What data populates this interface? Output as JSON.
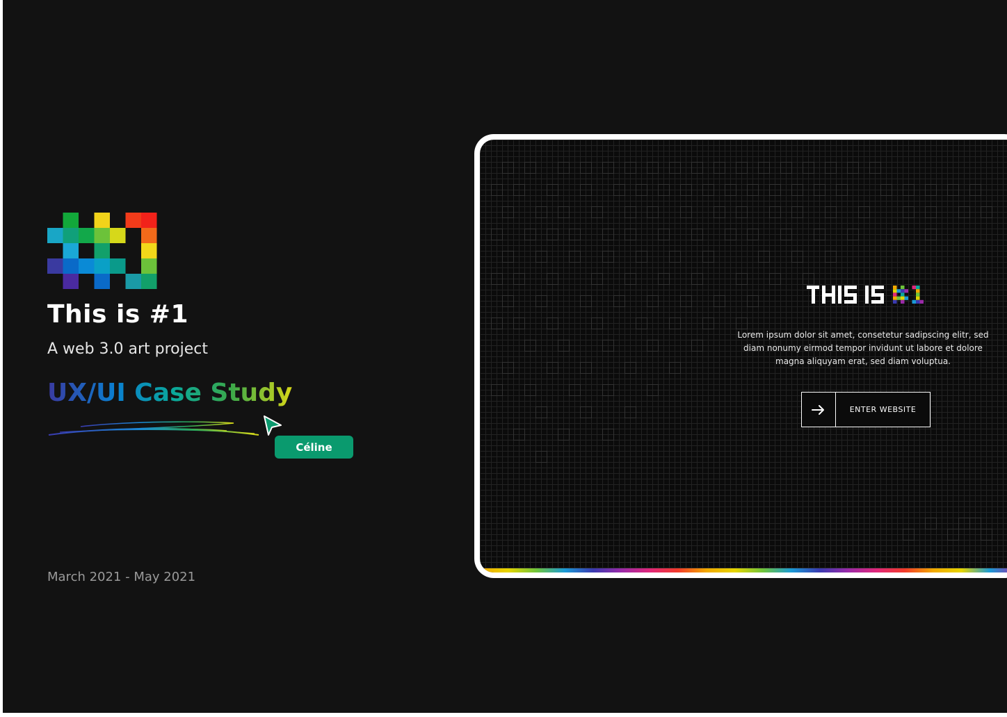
{
  "project": {
    "title": "This is #1",
    "subtitle": "A web 3.0 art project",
    "case_study": "UX/UI Case Study",
    "date_range": "March 2021 - May 2021"
  },
  "collaborator": {
    "name": "Céline",
    "color": "#0a9a6e"
  },
  "mockup": {
    "logo_text": "THIS IS #1",
    "description": "Lorem ipsum dolor sit amet, consetetur sadipscing elitr, sed diam nonumy eirmod tempor invidunt ut labore et dolore magna aliquyam erat, sed diam voluptua.",
    "enter_button": "ENTER WEBSITE",
    "arrow_icon": "arrow-right-icon"
  },
  "colors": {
    "background": "#121212",
    "accent_green": "#0a9a6e"
  }
}
